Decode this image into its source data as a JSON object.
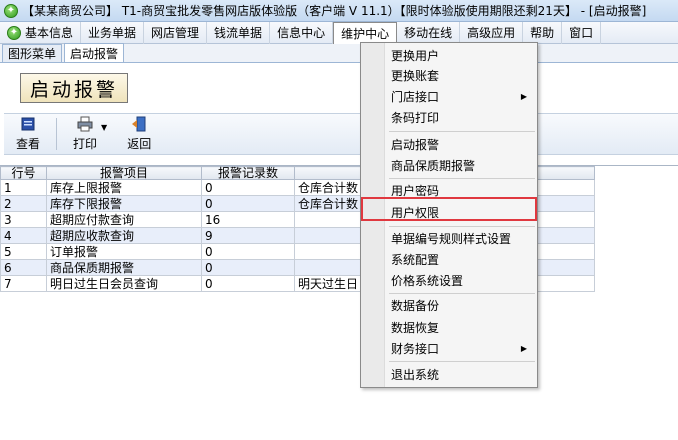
{
  "titlebar": {
    "title": "【某某商贸公司】 T1-商贸宝批发零售网店版体验版（客户端 V 11.1）【限时体验版使用期限还剩21天】 - [启动报警]"
  },
  "menubar": {
    "items": [
      "基本信息",
      "业务单据",
      "网店管理",
      "钱流单据",
      "信息中心",
      "维护中心",
      "移动在线",
      "高级应用",
      "帮助",
      "窗口"
    ]
  },
  "tabs": [
    "图形菜单",
    "启动报警"
  ],
  "page_heading": "启动报警",
  "toolbar": {
    "view": "查看",
    "print": "打印",
    "back": "返回"
  },
  "grid": {
    "columns": [
      "行号",
      "报警项目",
      "报警记录数",
      ""
    ],
    "rows": [
      [
        "1",
        "库存上限报警",
        "0",
        "仓库合计数"
      ],
      [
        "2",
        "库存下限报警",
        "0",
        "仓库合计数"
      ],
      [
        "3",
        "超期应付款查询",
        "16",
        ""
      ],
      [
        "4",
        "超期应收款查询",
        "9",
        ""
      ],
      [
        "5",
        "订单报警",
        "0",
        ""
      ],
      [
        "6",
        "商品保质期报警",
        "0",
        ""
      ],
      [
        "7",
        "明日过生日会员查询",
        "0",
        "明天过生日"
      ]
    ]
  },
  "dropdown": {
    "items": [
      "更换用户",
      "更换账套",
      "门店接口",
      "条码打印",
      "启动报警",
      "商品保质期报警",
      "用户密码",
      "用户权限",
      "单据编号规则样式设置",
      "系统配置",
      "价格系统设置",
      "数据备份",
      "数据恢复",
      "财务接口",
      "退出系统"
    ],
    "submenu_arrow": "▶"
  },
  "colors": {
    "highlight": "#e0383f",
    "accent": "#2e9a1e"
  }
}
